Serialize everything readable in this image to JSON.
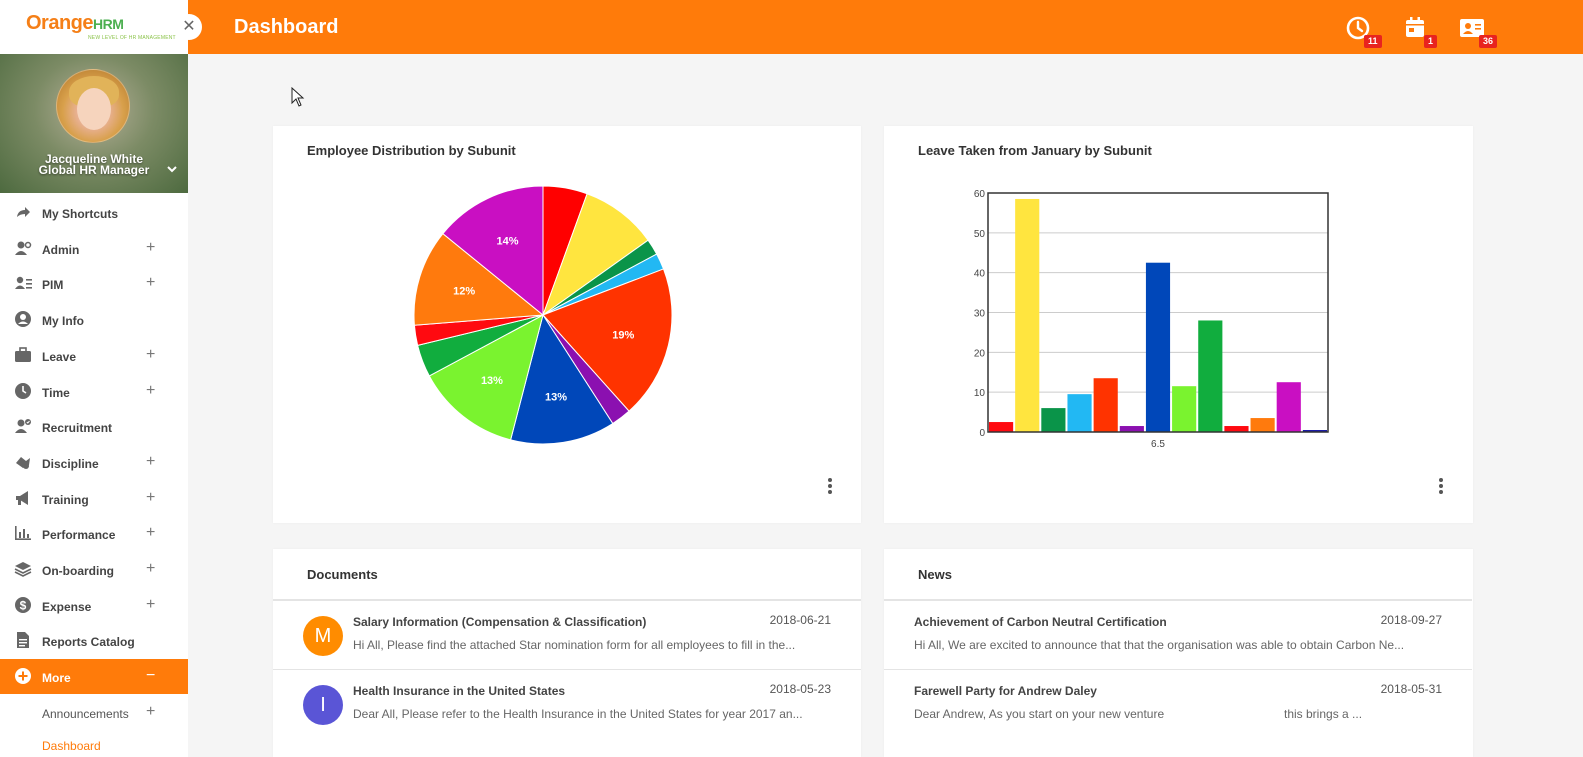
{
  "app": {
    "logo_text_orange": "Orange",
    "logo_text_hrm": "HRM",
    "logo_tagline": "NEW LEVEL OF HR MANAGEMENT"
  },
  "header": {
    "title": "Dashboard",
    "badges": {
      "time": "11",
      "calendar": "1",
      "contacts": "36"
    }
  },
  "profile": {
    "name": "Jacqueline White",
    "role": "Global HR Manager"
  },
  "sidebar": {
    "items": [
      {
        "label": "My Shortcuts",
        "icon": "share-icon",
        "expandable": false
      },
      {
        "label": "Admin",
        "icon": "admin-user-icon",
        "expandable": true
      },
      {
        "label": "PIM",
        "icon": "pim-icon",
        "expandable": true
      },
      {
        "label": "My Info",
        "icon": "user-circle-icon",
        "expandable": false
      },
      {
        "label": "Leave",
        "icon": "briefcase-icon",
        "expandable": true
      },
      {
        "label": "Time",
        "icon": "clock-icon",
        "expandable": true
      },
      {
        "label": "Recruitment",
        "icon": "recruitment-icon",
        "expandable": false
      },
      {
        "label": "Discipline",
        "icon": "discipline-icon",
        "expandable": true
      },
      {
        "label": "Training",
        "icon": "megaphone-icon",
        "expandable": true
      },
      {
        "label": "Performance",
        "icon": "bar-chart-icon",
        "expandable": true
      },
      {
        "label": "On-boarding",
        "icon": "stack-icon",
        "expandable": true
      },
      {
        "label": "Expense",
        "icon": "dollar-icon",
        "expandable": true
      },
      {
        "label": "Reports Catalog",
        "icon": "document-icon",
        "expandable": false
      },
      {
        "label": "More",
        "icon": "plus-circle-icon",
        "expandable": true,
        "expanded": true
      }
    ],
    "more_sub": [
      {
        "label": "Announcements"
      },
      {
        "label": "Dashboard"
      }
    ],
    "expand_symbol": "+",
    "collapse_symbol": "−"
  },
  "cards": {
    "distribution_title": "Employee Distribution by Subunit",
    "leave_title": "Leave Taken from January by Subunit",
    "documents_title": "Documents",
    "news_title": "News"
  },
  "chart_data": [
    {
      "type": "pie",
      "title": "Employee Distribution by Subunit",
      "slices": [
        {
          "value": 5.5,
          "color": "#ff0000",
          "label": ""
        },
        {
          "value": 9.5,
          "color": "#ffe53f",
          "label": ""
        },
        {
          "value": 2.0,
          "color": "#0a9449",
          "label": ""
        },
        {
          "value": 2.0,
          "color": "#22b8f3",
          "label": ""
        },
        {
          "value": 19.0,
          "color": "#ff3300",
          "label": "19%"
        },
        {
          "value": 2.5,
          "color": "#8b10b0",
          "label": ""
        },
        {
          "value": 13.0,
          "color": "#0047b9",
          "label": "13%"
        },
        {
          "value": 13.0,
          "color": "#7af32f",
          "label": "13%"
        },
        {
          "value": 4.0,
          "color": "#11ad3e",
          "label": ""
        },
        {
          "value": 2.5,
          "color": "#ff0a10",
          "label": ""
        },
        {
          "value": 12.0,
          "color": "#ff7a0d",
          "label": "12%"
        },
        {
          "value": 14.0,
          "color": "#c90fc2",
          "label": "14%"
        }
      ]
    },
    {
      "type": "bar",
      "title": "Leave Taken from January by Subunit",
      "categories": [
        "6.5"
      ],
      "ylim": [
        0,
        60
      ],
      "yticks": [
        0,
        10,
        20,
        30,
        40,
        50,
        60
      ],
      "series": [
        {
          "value": 2.5,
          "color": "#ff0a10"
        },
        {
          "value": 58.5,
          "color": "#ffe53f"
        },
        {
          "value": 6,
          "color": "#0a9449"
        },
        {
          "value": 9.5,
          "color": "#22b8f3"
        },
        {
          "value": 13.5,
          "color": "#ff3300"
        },
        {
          "value": 1.5,
          "color": "#8b10b0"
        },
        {
          "value": 42.5,
          "color": "#0047b9"
        },
        {
          "value": 11.5,
          "color": "#7af32f"
        },
        {
          "value": 28,
          "color": "#11ad3e"
        },
        {
          "value": 1.5,
          "color": "#ff0a10"
        },
        {
          "value": 3.5,
          "color": "#ff7a0d"
        },
        {
          "value": 12.5,
          "color": "#c90fc2"
        },
        {
          "value": 0.5,
          "color": "#1a1aa6"
        }
      ]
    }
  ],
  "documents": [
    {
      "avatar": "M",
      "avatar_color": "#ff8c00",
      "title": "Salary Information (Compensation & Classification)",
      "date": "2018-06-21",
      "snippet": "Hi All, Please find the attached Star nomination form for all employees to fill in the..."
    },
    {
      "avatar": "I",
      "avatar_color": "#5a55d6",
      "title": "Health Insurance in the United States",
      "date": "2018-05-23",
      "snippet": "Dear All, Please refer to the Health Insurance in the United States for year 2017 an..."
    }
  ],
  "news": [
    {
      "title": "Achievement of Carbon Neutral Certification",
      "date": "2018-09-27",
      "snippet": "Hi All, We are excited to announce that that the organisation was able to obtain Carbon Ne..."
    },
    {
      "title": "Farewell Party for Andrew Daley",
      "date": "2018-05-31",
      "snippet": "Dear Andrew, As you start on your new venture",
      "snippet_right": "this brings a ..."
    }
  ],
  "colors": {
    "accent": "#ff7b0a",
    "badge": "#e8231f"
  }
}
